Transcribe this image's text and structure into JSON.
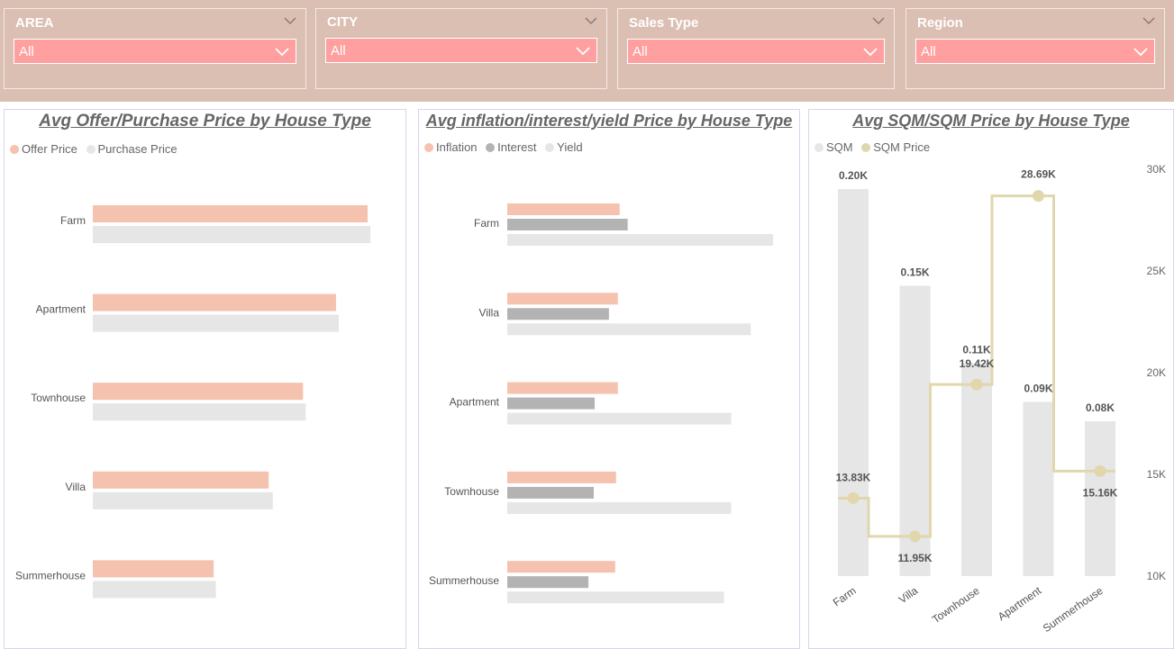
{
  "filters": [
    {
      "label": "AREA",
      "value": "All"
    },
    {
      "label": "CITY",
      "value": "All"
    },
    {
      "label": "Sales Type",
      "value": "All"
    },
    {
      "label": "Region",
      "value": "All"
    }
  ],
  "colors": {
    "filter_bar": "#dcbfb3",
    "dropdown": "#ff9f9f",
    "offer": "#f4c2ae",
    "purchase": "#e6e6e6",
    "inflation": "#f4c2ae",
    "interest": "#b3b3b3",
    "yield": "#e6e6e6",
    "sqm": "#e6e6e6",
    "sqm_price": "#e0d7ac"
  },
  "chart_data": [
    {
      "type": "bar",
      "orientation": "horizontal",
      "title": "Avg Offer/Purchase Price by House Type",
      "categories": [
        "Farm",
        "Apartment",
        "Townhouse",
        "Villa",
        "Summerhouse"
      ],
      "series": [
        {
          "name": "Offer Price",
          "values": [
            100,
            88.5,
            76.5,
            64,
            44
          ]
        },
        {
          "name": "Purchase Price",
          "values": [
            101,
            89.5,
            77.5,
            65.5,
            44.8
          ]
        }
      ],
      "legend": "top-left",
      "grid": false
    },
    {
      "type": "bar",
      "orientation": "horizontal",
      "title": "Avg inflation/interest/yield Price by House Type",
      "categories": [
        "Farm",
        "Villa",
        "Apartment",
        "Townhouse",
        "Summerhouse"
      ],
      "series": [
        {
          "name": "Inflation",
          "values": [
            1.26,
            1.24,
            1.24,
            1.22,
            1.21
          ]
        },
        {
          "name": "Interest",
          "values": [
            1.35,
            1.14,
            0.98,
            0.97,
            0.91
          ]
        },
        {
          "name": "Yield",
          "values": [
            2.98,
            2.73,
            2.51,
            2.51,
            2.43
          ]
        }
      ],
      "legend": "top-left",
      "grid": false
    },
    {
      "type": "bar",
      "combo": "bar + stepped line (secondary axis)",
      "title": "Avg SQM/SQM Price by House Type",
      "categories": [
        "Farm",
        "Villa",
        "Townhouse",
        "Apartment",
        "Summerhouse"
      ],
      "series": [
        {
          "name": "SQM",
          "values": [
            0.2,
            0.15,
            0.11,
            0.09,
            0.08
          ],
          "labels": [
            "0.20K",
            "0.15K",
            "0.11K",
            "0.09K",
            "0.08K"
          ],
          "axis": "primary (hidden)"
        },
        {
          "name": "SQM Price",
          "type": "line",
          "values": [
            13.83,
            11.95,
            19.42,
            28.69,
            15.16
          ],
          "labels": [
            "13.83K",
            "11.95K",
            "19.42K",
            "28.69K",
            "15.16K"
          ],
          "axis": "secondary"
        }
      ],
      "y2_ticks": [
        "30K",
        "25K",
        "20K",
        "15K",
        "10K"
      ],
      "y2lim": [
        10,
        30
      ],
      "legend": "top-left",
      "grid": false
    }
  ]
}
